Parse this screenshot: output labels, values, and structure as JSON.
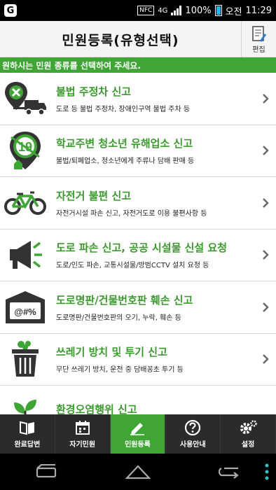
{
  "status_bar": {
    "nfc": "NFC",
    "network": "4G",
    "battery": "100%",
    "ampm": "오전",
    "time": "11:29"
  },
  "header": {
    "title": "민원등록(유형선택)",
    "edit_label": "편집"
  },
  "notice": "원하시는 민원 종류를 선택하여 주세요.",
  "items": [
    {
      "title": "불법 주정차 신고",
      "desc": "도로 등 불법 주정차, 장애인구역 불법 주차 등",
      "icon": "illegal-parking-icon"
    },
    {
      "title": "학교주변 청소년 유해업소 신고",
      "desc": "불법/퇴폐업소, 청소년에게 주류나 담배 판매 등",
      "icon": "school-zone-19-icon"
    },
    {
      "title": "자전거 불편 신고",
      "desc": "자전거시설 파손 신고, 자전거도로 이용 불편사항 등",
      "icon": "bicycle-icon"
    },
    {
      "title": "도로 파손 신고, 공공 시설물 신설 요청",
      "desc": "도로/인도 파손, 교통시설물/방범CCTV 설치 요청 등",
      "icon": "megaphone-icon"
    },
    {
      "title": "도로명판/건물번호판 훼손 신고",
      "desc": "도로명판/건물번호판의 오기, 누락, 훼손 등",
      "icon": "address-sign-icon"
    },
    {
      "title": "쓰레기 방치 및 투기 신고",
      "desc": "무단 쓰레기 방치, 운전 중 담배꽁초 투기 등",
      "icon": "trash-can-icon"
    },
    {
      "title": "환경오염행위 신고",
      "desc": "",
      "icon": "sprout-icon"
    }
  ],
  "address_sign_text": "@#%",
  "school_sign_text": "19",
  "tabs": [
    {
      "label": "완료답변",
      "icon": "book-icon"
    },
    {
      "label": "자기민원",
      "icon": "calendar-icon"
    },
    {
      "label": "민원등록",
      "icon": "pencil-icon"
    },
    {
      "label": "사용안내",
      "icon": "help-icon"
    },
    {
      "label": "설정",
      "icon": "gear-icon"
    }
  ],
  "colors": {
    "accent_green": "#3fa535",
    "title_green": "#3a9a2c",
    "tab_bg": "#2b2b2b",
    "icon_gray": "#333333"
  }
}
